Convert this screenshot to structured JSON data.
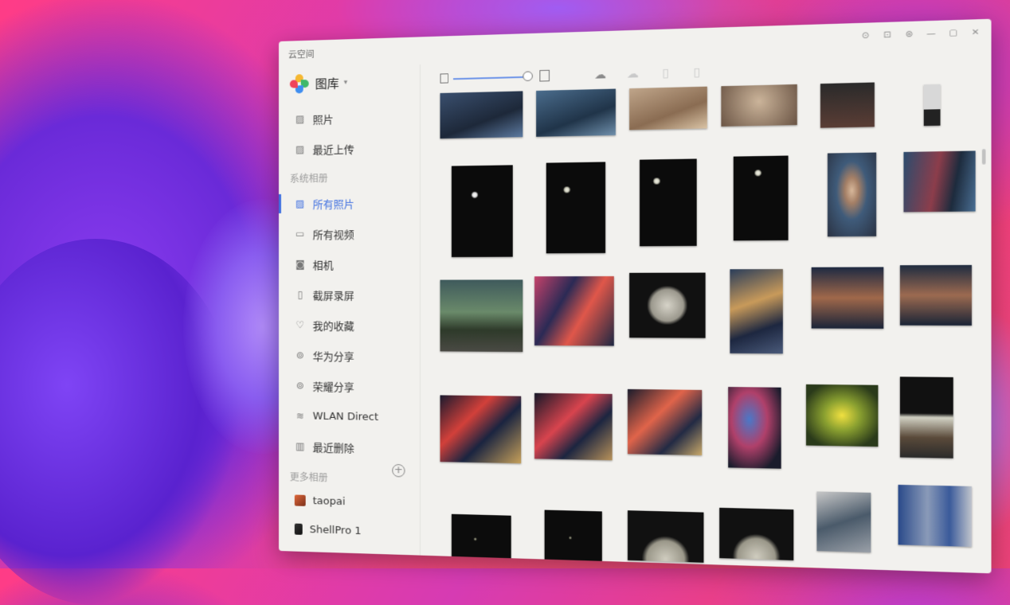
{
  "window": {
    "title": "云空间"
  },
  "window_controls": [
    "⊙",
    "⊡",
    "⊛",
    "—",
    "▢",
    "✕"
  ],
  "brand": {
    "name": "图库",
    "caret": "▾"
  },
  "nav": {
    "photos": "照片",
    "recent_upload": "最近上传",
    "system_albums_label": "系统相册",
    "all_photos": "所有照片",
    "all_videos": "所有视频",
    "camera": "相机",
    "screenshots": "截屏录屏",
    "favorites": "我的收藏",
    "huawei_share": "华为分享",
    "honor_share": "荣耀分享",
    "wlan_direct": "WLAN Direct",
    "recently_deleted": "最近删除",
    "more_albums_label": "更多相册",
    "album_taopai": "taopai",
    "album_shellpro": "ShellPro 1"
  },
  "toolbar": {
    "upload_icon": "cloud-upload-icon",
    "download_icon": "cloud-download-icon",
    "copy_icon": "copy-icon",
    "device_icon": "phone-icon"
  },
  "colors": {
    "accent": "#3f6fe0",
    "window_bg": "#f2f1ee",
    "wallpaper_pink": "#f5407a",
    "wallpaper_purple": "#8a3cf0"
  }
}
